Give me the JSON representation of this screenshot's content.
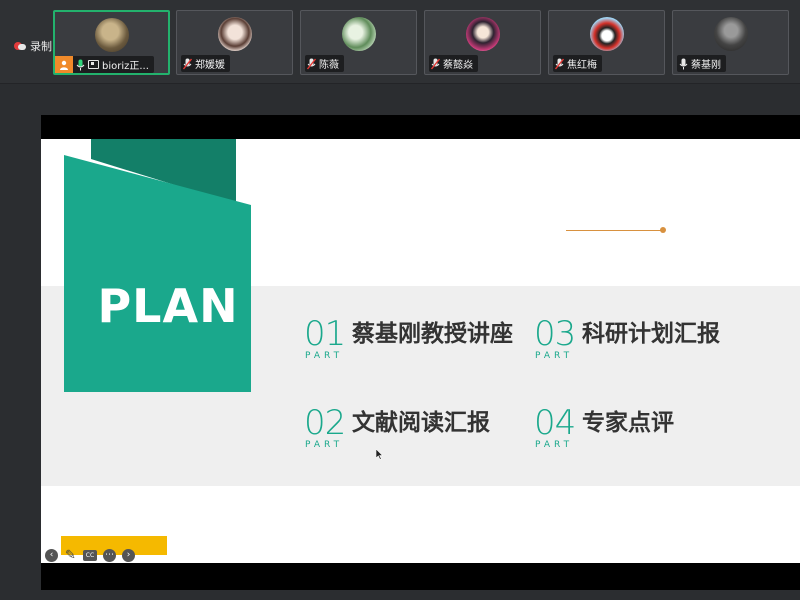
{
  "recording": {
    "label": "录制中"
  },
  "participants": [
    {
      "name": "bioriz正...",
      "active": true,
      "host": true,
      "mic": "on",
      "avatar_colors": [
        "#6b5a3e",
        "#c9b48a"
      ]
    },
    {
      "name": "郑媛媛",
      "active": false,
      "host": false,
      "mic": "muted",
      "avatar_colors": [
        "#e9d9d2",
        "#3b2b27"
      ]
    },
    {
      "name": "陈薇",
      "active": false,
      "host": false,
      "mic": "muted",
      "avatar_colors": [
        "#c8e0c4",
        "#5f8c5a"
      ]
    },
    {
      "name": "蔡懿焱",
      "active": false,
      "host": false,
      "mic": "muted",
      "avatar_colors": [
        "#f3d6e2",
        "#c83b79"
      ]
    },
    {
      "name": "焦红梅",
      "active": false,
      "host": false,
      "mic": "muted",
      "avatar_colors": [
        "#9fd3f2",
        "#d6312a"
      ]
    },
    {
      "name": "蔡基刚",
      "active": false,
      "host": false,
      "mic": "on",
      "avatar_colors": [
        "#444444",
        "#9a9a9a"
      ]
    }
  ],
  "slide": {
    "heading": "PLAN",
    "part_label": "PART",
    "items": [
      {
        "num": "01",
        "title": "蔡基刚教授讲座"
      },
      {
        "num": "02",
        "title": "文献阅读汇报"
      },
      {
        "num": "03",
        "title": "科研计划汇报"
      },
      {
        "num": "04",
        "title": "专家点评"
      }
    ],
    "colors": {
      "teal": "#1aa88c",
      "teal_dark": "#137f68",
      "orange": "#d8913f",
      "yellow": "#f5b900"
    }
  },
  "slide_controls": [
    {
      "name": "previous-slide",
      "icon": "arrow-left-icon"
    },
    {
      "name": "pen",
      "icon": "pen-icon"
    },
    {
      "name": "captions",
      "icon": "captions-icon"
    },
    {
      "name": "more",
      "icon": "more-icon"
    },
    {
      "name": "next-slide",
      "icon": "arrow-right-icon"
    }
  ]
}
